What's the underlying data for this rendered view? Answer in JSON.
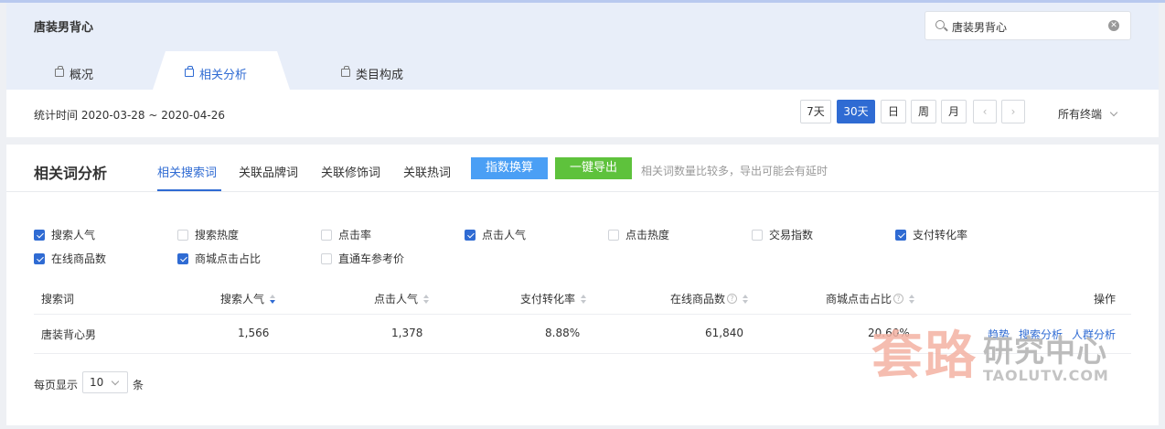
{
  "header": {
    "keyword_title": "唐装男背心",
    "search_value": "唐装男背心",
    "tabs": [
      "概况",
      "相关分析",
      "类目构成"
    ],
    "active_tab": "相关分析",
    "period_label": "统计时间 2020-03-28 ~ 2020-04-26",
    "date_buttons": [
      "7天",
      "30天",
      "日",
      "周",
      "月"
    ],
    "active_range": "30天",
    "terminal": "所有终端"
  },
  "analysis": {
    "title": "相关词分析",
    "sub_tabs": [
      "相关搜索词",
      "关联品牌词",
      "关联修饰词",
      "关联热词"
    ],
    "active_sub_tab": "相关搜索词",
    "index_button": "指数换算",
    "export_button": "一键导出",
    "tip": "相关词数量比较多，导出可能会有延时"
  },
  "metrics": [
    {
      "label": "搜索人气",
      "checked": true
    },
    {
      "label": "搜索热度",
      "checked": false
    },
    {
      "label": "点击率",
      "checked": false
    },
    {
      "label": "点击人气",
      "checked": true
    },
    {
      "label": "点击热度",
      "checked": false
    },
    {
      "label": "交易指数",
      "checked": false
    },
    {
      "label": "支付转化率",
      "checked": true
    },
    {
      "label": "在线商品数",
      "checked": true
    },
    {
      "label": "商城点击占比",
      "checked": true
    },
    {
      "label": "直通车参考价",
      "checked": false
    }
  ],
  "table": {
    "columns": [
      "搜索词",
      "搜索人气",
      "点击人气",
      "支付转化率",
      "在线商品数",
      "商城点击占比",
      "操作"
    ],
    "rows": [
      {
        "keyword": "唐装背心男",
        "search_popularity": "1,566",
        "click_popularity": "1,378",
        "conversion": "8.88%",
        "online_items": "61,840",
        "mall_click_ratio": "20.60%",
        "actions": [
          "趋势",
          "搜索分析",
          "人群分析"
        ]
      }
    ]
  },
  "pagination": {
    "prefix": "每页显示",
    "value": "10",
    "suffix": "条"
  },
  "watermark": {
    "big": "套路",
    "small1": "研究中心",
    "small2": "TAOLUTV.COM"
  },
  "colors": {
    "accent": "#2f6bd3",
    "index_btn": "#4a9ff5",
    "export_btn": "#5ec23c",
    "header_band": "#e8eef9"
  }
}
